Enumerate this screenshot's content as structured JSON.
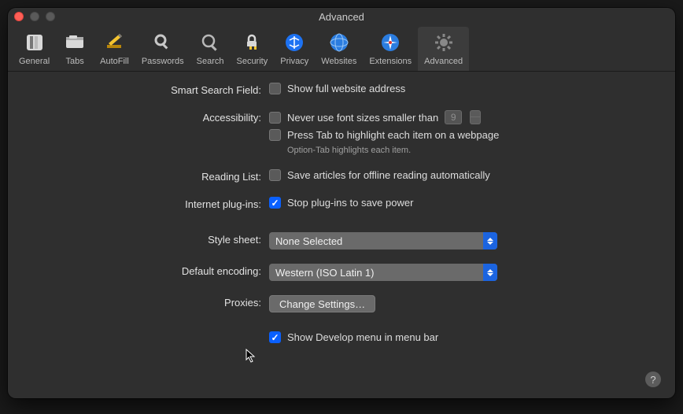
{
  "window": {
    "title": "Advanced"
  },
  "toolbar": {
    "items": [
      {
        "label": "General"
      },
      {
        "label": "Tabs"
      },
      {
        "label": "AutoFill"
      },
      {
        "label": "Passwords"
      },
      {
        "label": "Search"
      },
      {
        "label": "Security"
      },
      {
        "label": "Privacy"
      },
      {
        "label": "Websites"
      },
      {
        "label": "Extensions"
      },
      {
        "label": "Advanced"
      }
    ],
    "selected_index": 9
  },
  "sections": {
    "smart_search": {
      "label": "Smart Search Field:",
      "show_full_url": {
        "text": "Show full website address",
        "checked": false
      }
    },
    "accessibility": {
      "label": "Accessibility:",
      "min_font": {
        "text": "Never use font sizes smaller than",
        "checked": false,
        "value": "9"
      },
      "press_tab": {
        "text": "Press Tab to highlight each item on a webpage",
        "checked": false
      },
      "hint": "Option-Tab highlights each item."
    },
    "reading_list": {
      "label": "Reading List:",
      "save_offline": {
        "text": "Save articles for offline reading automatically",
        "checked": false
      }
    },
    "plugins": {
      "label": "Internet plug-ins:",
      "stop_plugins": {
        "text": "Stop plug-ins to save power",
        "checked": true
      }
    },
    "style_sheet": {
      "label": "Style sheet:",
      "value": "None Selected"
    },
    "encoding": {
      "label": "Default encoding:",
      "value": "Western (ISO Latin 1)"
    },
    "proxies": {
      "label": "Proxies:",
      "button": "Change Settings…"
    },
    "develop": {
      "text": "Show Develop menu in menu bar",
      "checked": true
    }
  },
  "help_tooltip": "?"
}
